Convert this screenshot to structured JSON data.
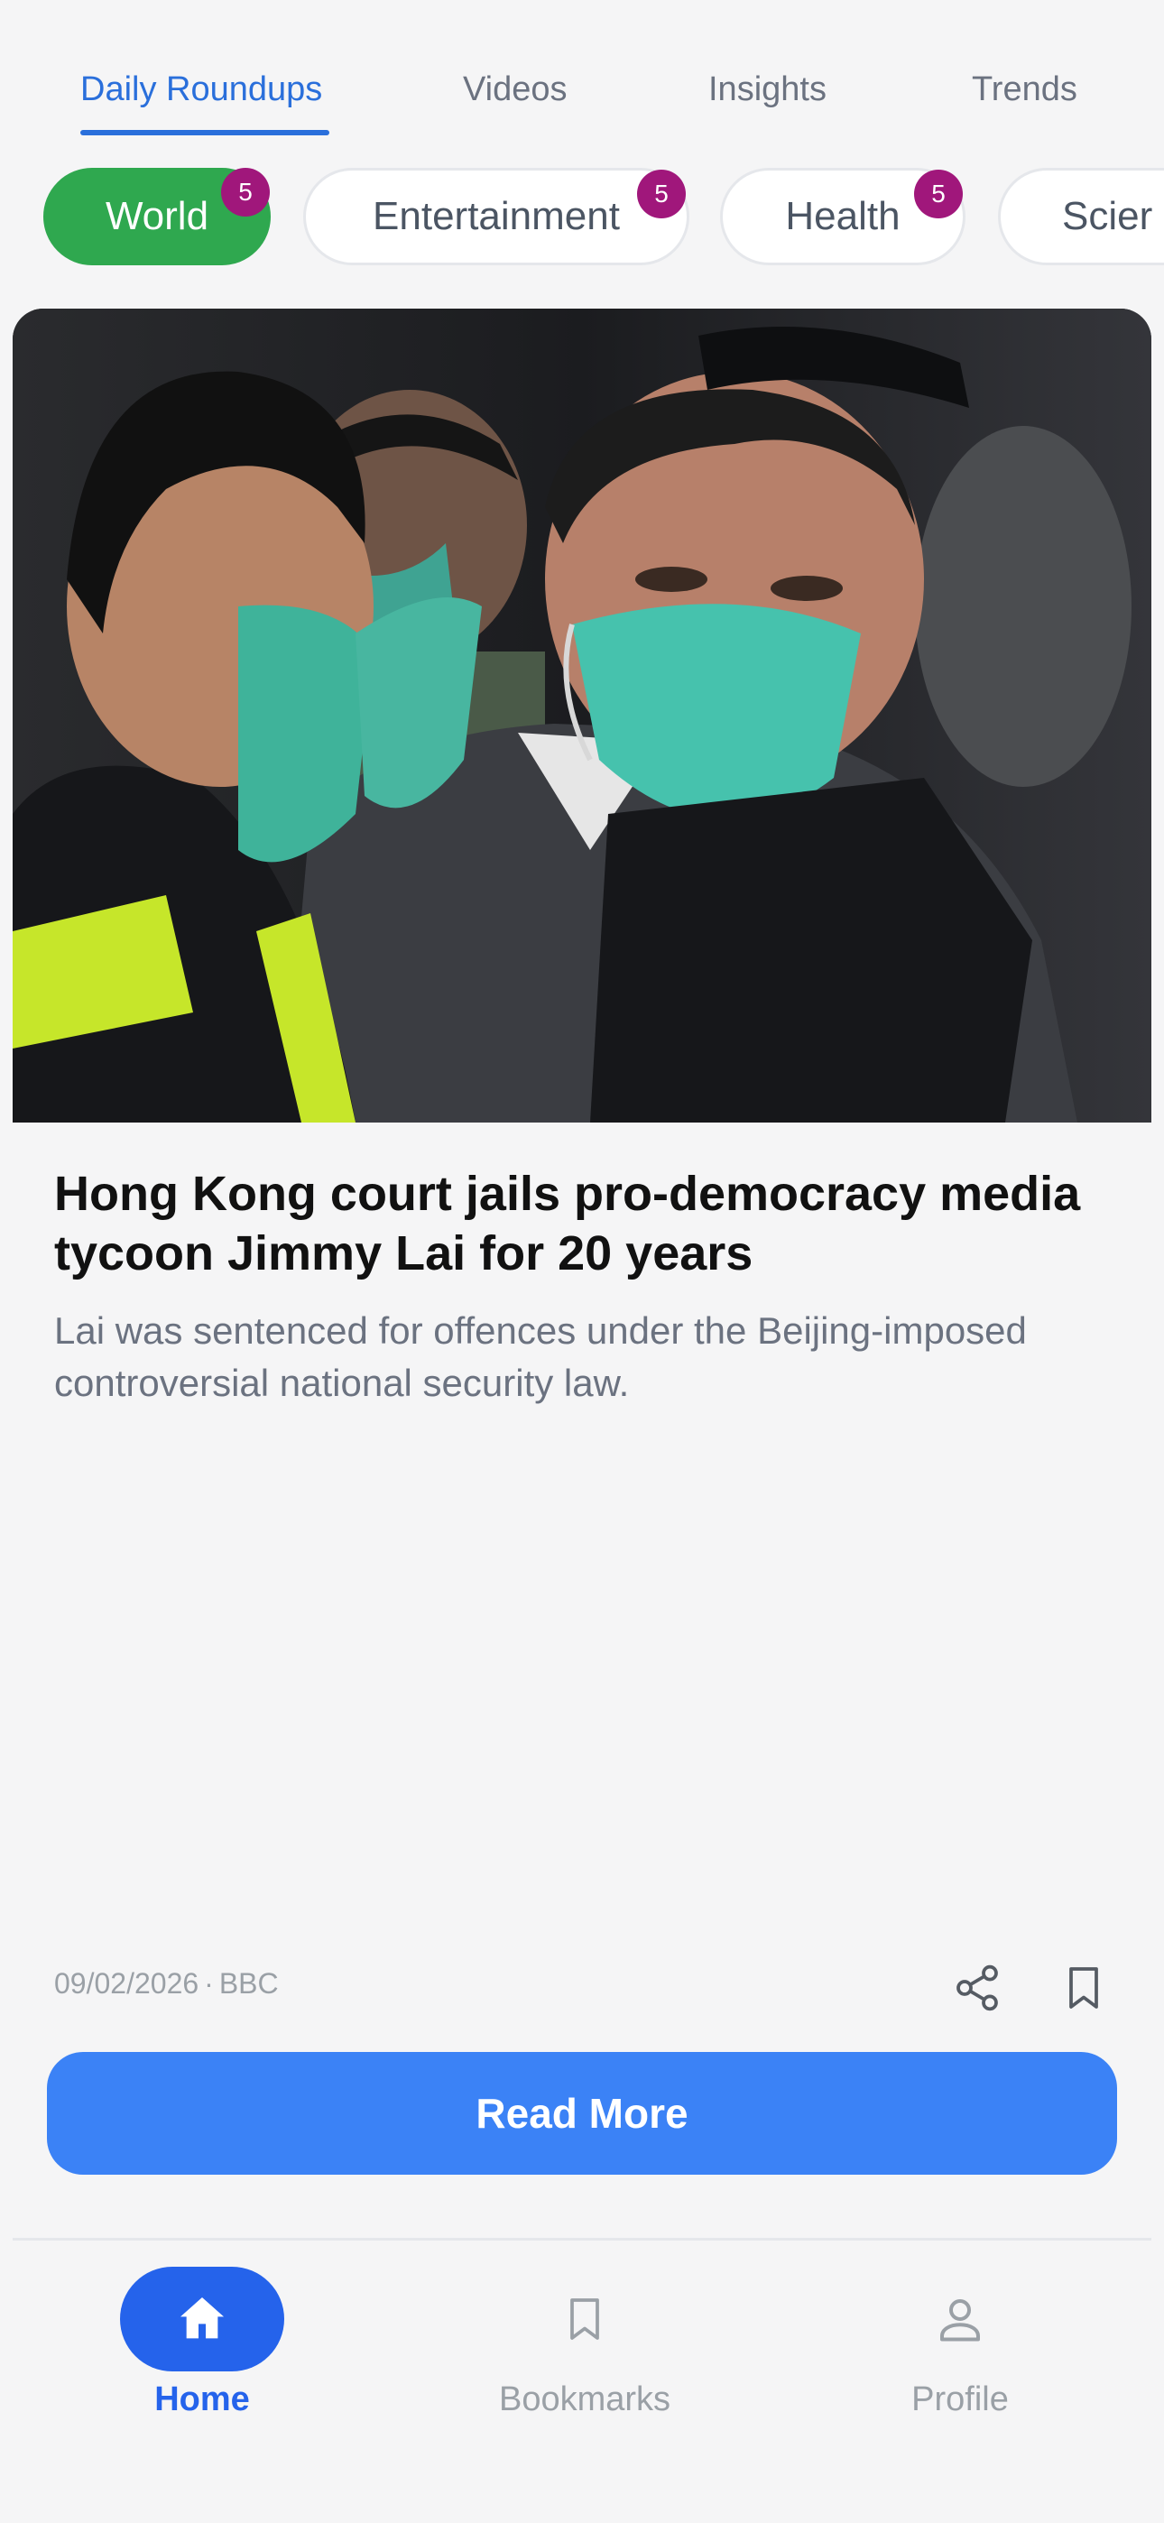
{
  "tabs": [
    {
      "label": "Daily Roundups",
      "active": true
    },
    {
      "label": "Videos",
      "active": false
    },
    {
      "label": "Insights",
      "active": false
    },
    {
      "label": "Trends",
      "active": false
    }
  ],
  "categories": [
    {
      "label": "World",
      "count": "5",
      "active": true
    },
    {
      "label": "Entertainment",
      "count": "5",
      "active": false
    },
    {
      "label": "Health",
      "count": "5",
      "active": false
    },
    {
      "label": "Scier",
      "active": false
    }
  ],
  "article": {
    "headline": "Hong Kong court jails pro-democracy media tycoon Jimmy Lai for 20 years",
    "summary": "Lai was sentenced for offences under the Beijing-imposed controversial national security law.",
    "date": "09/02/2026",
    "separator": "·",
    "source": "BBC"
  },
  "actions": {
    "share_icon": "share-icon",
    "bookmark_icon": "bookmark-icon",
    "read_more_label": "Read More"
  },
  "bottom_nav": [
    {
      "label": "Home",
      "icon": "home-icon",
      "active": true
    },
    {
      "label": "Bookmarks",
      "icon": "bookmark-icon",
      "active": false
    },
    {
      "label": "Profile",
      "icon": "person-icon",
      "active": false
    }
  ],
  "colors": {
    "accent_blue": "#2a6fdb",
    "active_pill_green": "#2fa84f",
    "badge_purple": "#a0177b",
    "button_blue": "#3b82f6"
  }
}
